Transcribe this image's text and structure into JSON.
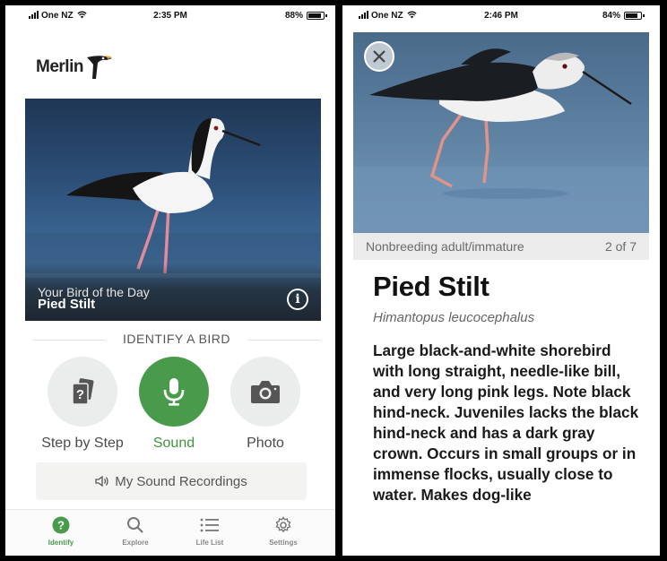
{
  "left": {
    "status": {
      "carrier": "One NZ",
      "time": "2:35 PM",
      "battery": "88%",
      "battery_level": 0.88
    },
    "app": {
      "logo": "Merlin"
    },
    "bird_of_day": {
      "caption": "Your Bird of the Day",
      "name": "Pied Stilt",
      "info_icon": "info-icon"
    },
    "identify": {
      "title": "IDENTIFY A BIRD",
      "options": [
        {
          "label": "Step by Step",
          "icon": "cards-question-icon"
        },
        {
          "label": "Sound",
          "icon": "microphone-icon"
        },
        {
          "label": "Photo",
          "icon": "camera-icon"
        }
      ],
      "recordings": {
        "icon": "speaker-icon",
        "label": "My Sound Recordings"
      }
    },
    "tabs": [
      {
        "label": "Identify",
        "icon": "question-circle-icon",
        "active": true
      },
      {
        "label": "Explore",
        "icon": "search-icon",
        "active": false
      },
      {
        "label": "Life List",
        "icon": "list-icon",
        "active": false
      },
      {
        "label": "Settings",
        "icon": "gear-icon",
        "active": false
      }
    ],
    "colors": {
      "accent": "#4a9a4c"
    }
  },
  "right": {
    "status": {
      "carrier": "One NZ",
      "time": "2:46 PM",
      "battery": "84%",
      "battery_level": 0.84
    },
    "photo": {
      "caption": "Nonbreeding adult/immature",
      "count": "2 of 7",
      "close_icon": "close-icon"
    },
    "species": {
      "name": "Pied Stilt",
      "scientific": "Himantopus leucocephalus",
      "description": "Large black-and-white shorebird with long straight, needle-like bill, and very long pink legs. Note black hind-neck. Juveniles lacks the black hind-neck and has a dark gray crown. Occurs in small groups or in immense flocks, usually close to water. Makes dog-like"
    }
  }
}
